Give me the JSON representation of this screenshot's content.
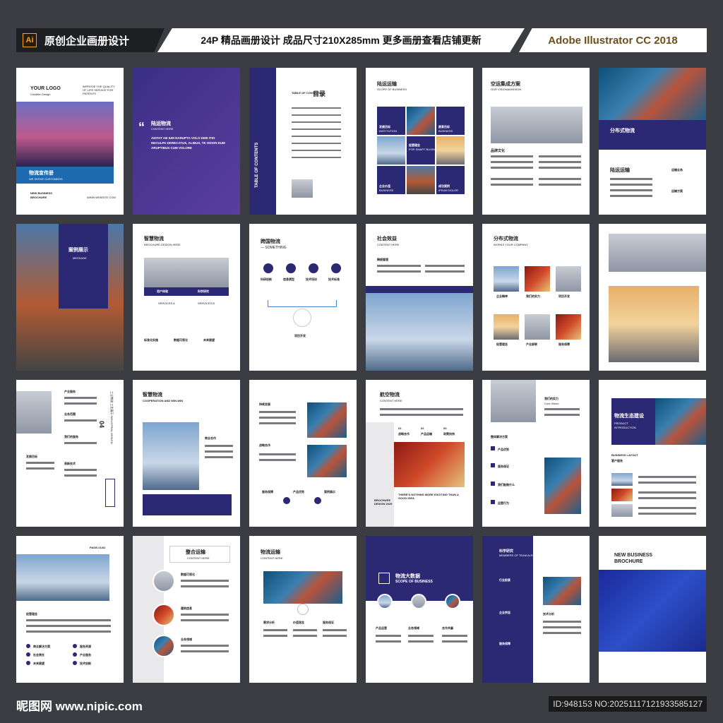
{
  "header": {
    "ai_badge": "Ai",
    "title": "原创企业画册设计",
    "spec": "24P 精品画册设计 成品尺寸210X285mm 更多画册查看店铺更新",
    "software": "Adobe Illustrator CC 2018"
  },
  "pages": {
    "p1": {
      "logo": "YOUR LOGO",
      "logo_sub": "Creative Design",
      "band": "物流宣传册",
      "band_sub": "WE SERVE CUSTOMERS",
      "bottom1": "NEW BUSINESS",
      "bottom2": "BROCHURE",
      "site": "WWW.WEBSITE.COM",
      "tag": "IMPROVE THE QUALITY OF LIFE SERVICE FOR PATIENTS"
    },
    "p2": {
      "title": "陆运物流",
      "sub": "CONTENT HERE",
      "body": "ADITAT AB IUM NARUPTA VOLO DEB ITIO NECULPA DERECATUS, ALIBUS, TE ODION EUM ARUPTIBUS CUM VOLORE"
    },
    "p3": {
      "vert": "TABLE OF CONTENTS",
      "toc_en": "TABLE OF CONTENTS",
      "toc": "目录"
    },
    "p4": {
      "title": "陆运运输",
      "sub": "SCOPE OF BUSINESS",
      "c1": "发展目标",
      "c1e": "INSTITUTION",
      "c2": "愿景目标",
      "c2e": "BUSINESS",
      "c3": "经营理念",
      "c3e": "FOR SMART BUSINESS",
      "c4": "企业价值",
      "c4e": "BUSINESS",
      "c5": "成功案例",
      "c5e": "IPSUM DOLOR"
    },
    "p5": {
      "title": "空运集成方案",
      "sub": "OUR VISIONAMISSION",
      "label": "品牌文化"
    },
    "p6": {
      "band": "分布式物流",
      "title": "陆运运输",
      "i1": "运输业务",
      "i2": "运输方案"
    },
    "p7": {
      "title": "案例展示",
      "sub": "MESSAGE"
    },
    "p8": {
      "title": "智慧物流",
      "sub": "BROCHURE DESIGN HERE",
      "b1": "用户体验",
      "b2": "科学研究",
      "s1": "SERVICES A",
      "s2": "SERVICES B",
      "f1": "标准化实施",
      "f2": "数据可视化",
      "f3": "未来展望"
    },
    "p9": {
      "title": "跨国物流",
      "sub": "— SOMETHING",
      "i1": "科研创新",
      "i2": "信息模型",
      "i3": "技术培训",
      "i4": "技术标准",
      "center": "项目开发"
    },
    "p10": {
      "title": "社会效益",
      "sub": "CONTENT HERE",
      "label": "精细管理"
    },
    "p11": {
      "title": "分布式物流",
      "sub": "WORKS YOUR COMPANY",
      "l1": "企业精神",
      "l2": "我们的实力",
      "l3": "项目开发",
      "l4": "经营理念",
      "l5": "产业部联",
      "l6": "服务保障"
    },
    "p13": {
      "l1": "产业服务",
      "l2": "业务范围",
      "l3": "我们的服务",
      "l4": "发展目标",
      "l5": "高新技术",
      "num": "04",
      "vtext": "工业物流·工艺展示 INDUSTRIAL DESIGN"
    },
    "p14": {
      "title": "智慧物流",
      "sub": "COOPERATION AND WIN-WIN",
      "label": "商业合作"
    },
    "p15": {
      "l1": "持续发展",
      "l2": "战略合作",
      "b1": "服务保障",
      "b2": "产品优势",
      "b3": "案例展示"
    },
    "p16": {
      "title": "航空物流",
      "sub": "CONTENT HERE",
      "n1": "01",
      "n2": "02",
      "n3": "03",
      "t1": "战略合作",
      "t2": "产品运输",
      "t3": "政策扶持",
      "side": "BROCHURE DESIGN 2025",
      "slogan": "THERE'S NOTHING MORE EXCITING THAN A GOOD IDEA"
    },
    "p17": {
      "title": "我们的实力",
      "sub": "Core Vision",
      "l0": "整体解决方案",
      "l1": "产品优势",
      "l2": "服务保证",
      "l3": "我们能做什么",
      "l4": "运营行为"
    },
    "p18": {
      "band": "物流生态建设",
      "band_e1": "PRODUCT",
      "band_e2": "INTRODUCTION",
      "layout": "BUSINESS LAYOUT",
      "client": "客户服务"
    },
    "p19": {
      "page": "PAGE-01/02",
      "label": "经营理念",
      "i1": "商业解决方案",
      "i2": "服务资源",
      "i3": "社会责任",
      "i4": "产业服务",
      "i5": "未来展望",
      "i6": "技术创新"
    },
    "p20": {
      "title": "整合运输",
      "sub": "CONTENT HERE",
      "l1": "数据可视化",
      "l2": "建筑信息",
      "l3": "业务领域"
    },
    "p21": {
      "title": "物流运输",
      "sub": "CONTENT HERE",
      "c1": "需求分析",
      "c2": "价值观念",
      "c3": "服务保证"
    },
    "p22": {
      "title": "物流大数据",
      "sub": "SCOPE OF BUSINESS",
      "l1": "产品运营",
      "l2": "业务领域",
      "l3": "合作共赢"
    },
    "p23": {
      "title": "科学研究",
      "sub": "MEMBERS OF TEAM ALREADY TO",
      "l1": "行业前景",
      "l2": "企业宗旨",
      "l3": "服务保障",
      "l4": "技术分析"
    },
    "p24": {
      "t1": "NEW  BUSINESS",
      "t2": "BROCHURE"
    }
  },
  "footer": {
    "logo": "昵图网 www.nipic.com",
    "id": "ID:948153 NO:20251117121933585127"
  },
  "colors": {
    "navy": "#2b2874",
    "bg": "#3b3d42",
    "accent_blue": "#1e6ab0"
  }
}
